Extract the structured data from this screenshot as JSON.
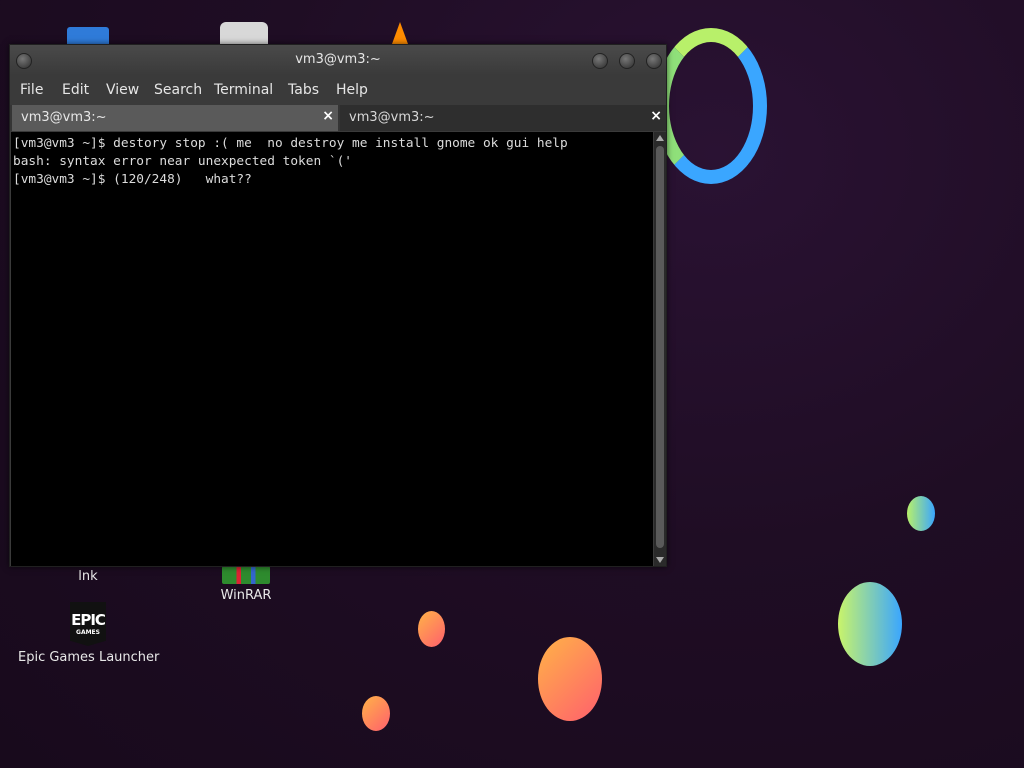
{
  "desktop": {
    "icons": [
      {
        "label": "lnk"
      },
      {
        "label": "WinRAR"
      },
      {
        "label": "Epic Games Launcher",
        "logo_text_top": "EPIC",
        "logo_text_bottom": "GAMES"
      }
    ]
  },
  "window": {
    "title": "vm3@vm3:~",
    "menu": [
      "File",
      "Edit",
      "View",
      "Search",
      "Terminal",
      "Tabs",
      "Help"
    ],
    "tabs": [
      {
        "label": "vm3@vm3:~",
        "close": "×"
      },
      {
        "label": "vm3@vm3:~",
        "close": "×"
      }
    ],
    "terminal_lines": [
      "[vm3@vm3 ~]$ destory stop :( me  no destroy me install gnome ok gui help",
      "bash: syntax error near unexpected token `('",
      "[vm3@vm3 ~]$ (120/248)   what??"
    ]
  },
  "colors": {
    "desktop_bg": "#1f0d24",
    "terminal_bg": "#000000",
    "terminal_fg": "#dcdcdc"
  }
}
